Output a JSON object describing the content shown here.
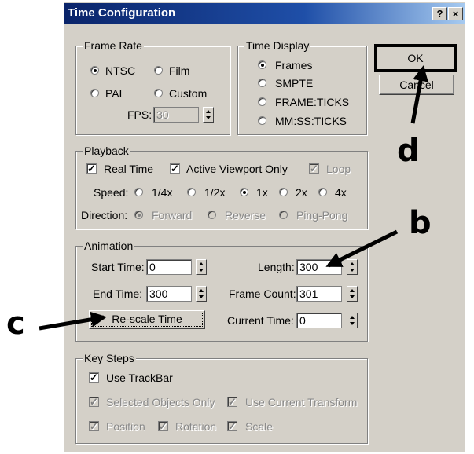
{
  "dialog": {
    "title": "Time Configuration",
    "help_label": "?",
    "close_label": "×"
  },
  "frame_rate": {
    "title": "Frame Rate",
    "options": [
      {
        "label": "NTSC",
        "selected": true
      },
      {
        "label": "Film",
        "selected": false
      },
      {
        "label": "PAL",
        "selected": false
      },
      {
        "label": "Custom",
        "selected": false
      }
    ],
    "fps_label": "FPS:",
    "fps_value": "30"
  },
  "time_display": {
    "title": "Time Display",
    "options": [
      {
        "label": "Frames",
        "selected": true
      },
      {
        "label": "SMPTE",
        "selected": false
      },
      {
        "label": "FRAME:TICKS",
        "selected": false
      },
      {
        "label": "MM:SS:TICKS",
        "selected": false
      }
    ]
  },
  "buttons": {
    "ok_label": "OK",
    "cancel_label": "Cancel"
  },
  "playback": {
    "title": "Playback",
    "real_time_label": "Real Time",
    "real_time_checked": true,
    "active_viewport_label": "Active Viewport Only",
    "active_viewport_checked": true,
    "loop_label": "Loop",
    "loop_checked": true,
    "speed_label": "Speed:",
    "speed_options": [
      {
        "label": "1/4x",
        "selected": false
      },
      {
        "label": "1/2x",
        "selected": false
      },
      {
        "label": "1x",
        "selected": true
      },
      {
        "label": "2x",
        "selected": false
      },
      {
        "label": "4x",
        "selected": false
      }
    ],
    "direction_label": "Direction:",
    "direction_options": [
      {
        "label": "Forward",
        "selected": true
      },
      {
        "label": "Reverse",
        "selected": false
      },
      {
        "label": "Ping-Pong",
        "selected": false
      }
    ]
  },
  "animation": {
    "title": "Animation",
    "start_time_label": "Start Time:",
    "start_time_value": "0",
    "end_time_label": "End Time:",
    "end_time_value": "300",
    "length_label": "Length:",
    "length_value": "300",
    "frame_count_label": "Frame Count:",
    "frame_count_value": "301",
    "current_time_label": "Current Time:",
    "current_time_value": "0",
    "rescale_label": "Re-scale Time"
  },
  "key_steps": {
    "title": "Key Steps",
    "use_trackbar_label": "Use TrackBar",
    "use_trackbar_checked": true,
    "selected_objects_label": "Selected Objects Only",
    "selected_objects_checked": true,
    "use_current_transform_label": "Use Current Transform",
    "use_current_transform_checked": true,
    "position_label": "Position",
    "position_checked": true,
    "rotation_label": "Rotation",
    "rotation_checked": true,
    "scale_label": "Scale",
    "scale_checked": true
  },
  "annotations": {
    "b": "b",
    "c": "c",
    "d": "d"
  },
  "colors": {
    "dialog_face": "#d4d0c8",
    "titlebar_start": "#0a246a",
    "titlebar_end": "#a6caf0",
    "annotation": "#000000"
  },
  "check_mark": "✓"
}
